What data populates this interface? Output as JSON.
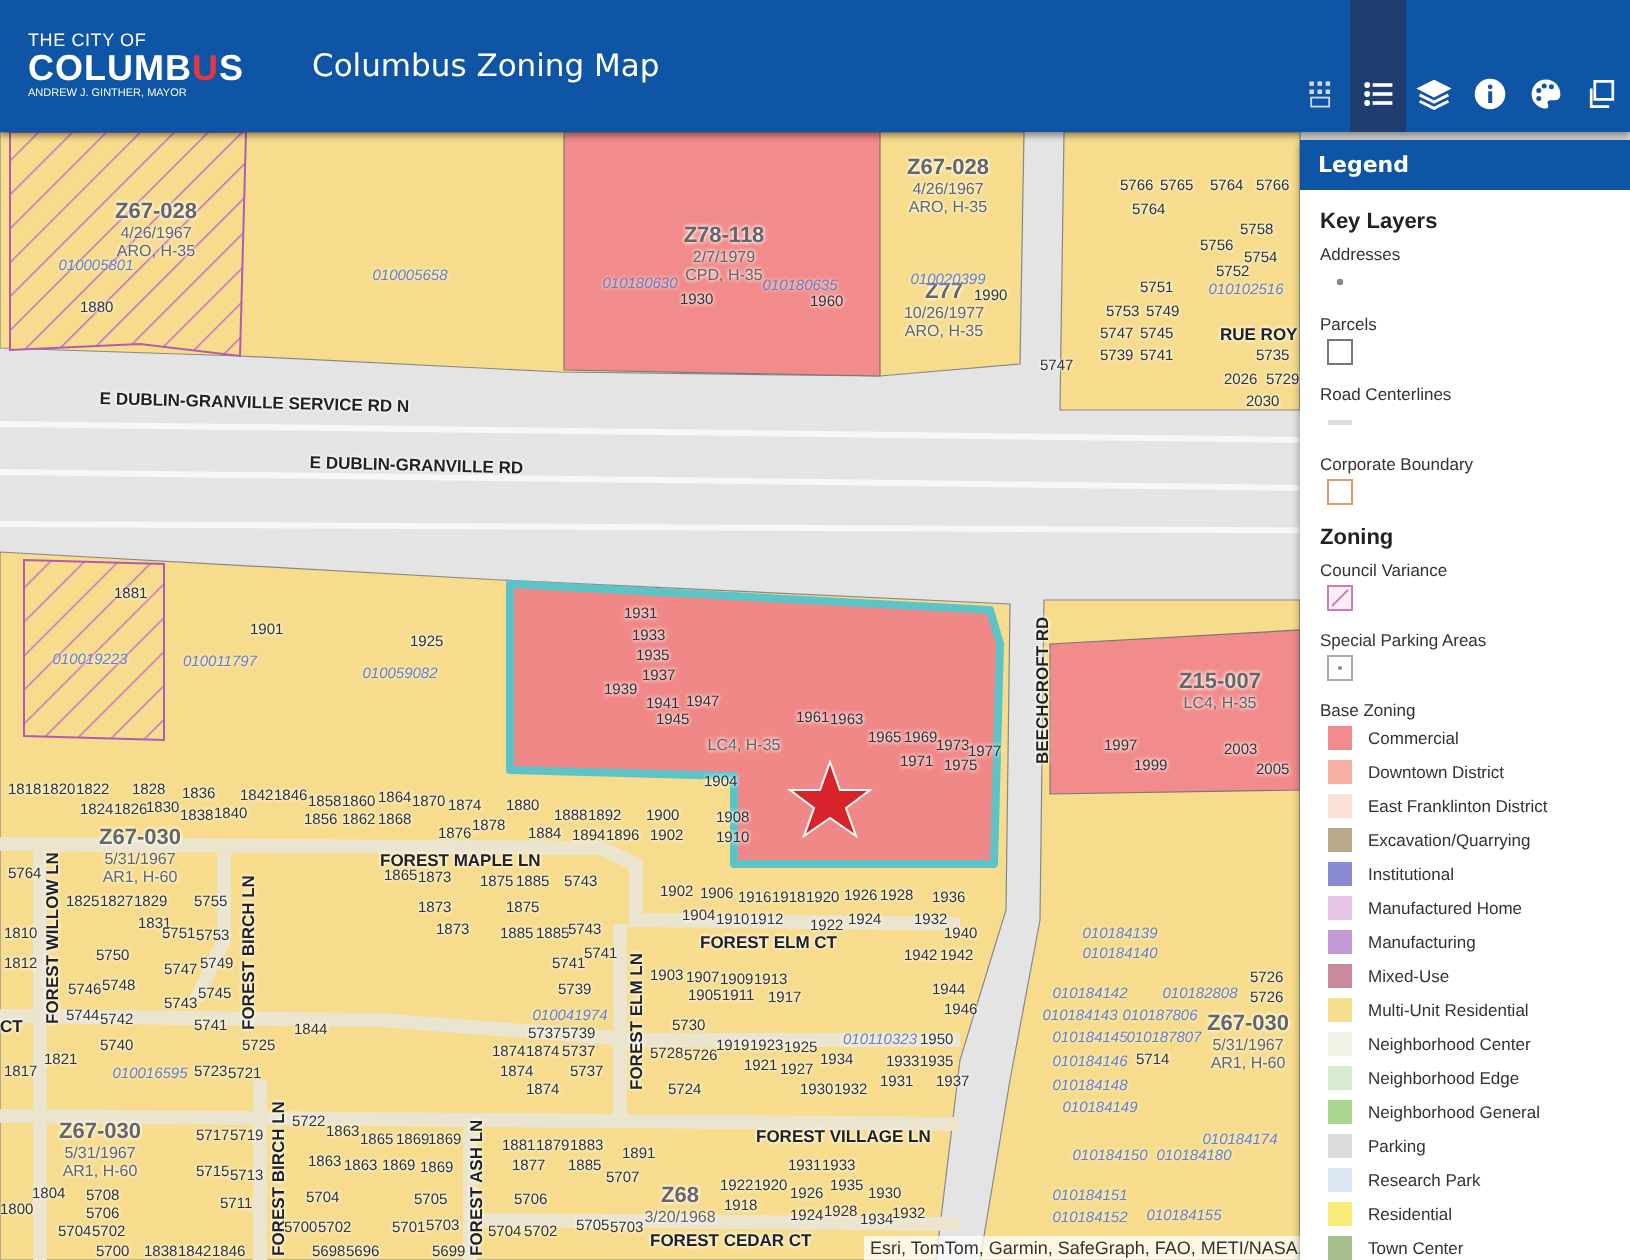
{
  "header": {
    "logo": {
      "line1": "THE CITY OF",
      "name_parts": [
        {
          "text": "COLUMB",
          "accent": false
        },
        {
          "text": "U",
          "accent": true
        },
        {
          "text": "S",
          "accent": false
        }
      ],
      "tagline": "ANDREW J. GINTHER, MAYOR"
    },
    "title": "Columbus Zoning Map",
    "tools": [
      {
        "kind": "basemap",
        "selected": false
      },
      {
        "kind": "legend",
        "selected": true
      },
      {
        "kind": "layers",
        "selected": false
      },
      {
        "kind": "info",
        "selected": false
      },
      {
        "kind": "palette",
        "selected": false
      },
      {
        "kind": "print",
        "selected": false
      }
    ]
  },
  "legend": {
    "title": "Legend",
    "sections": [
      {
        "heading": "Key Layers",
        "items": [
          {
            "label": "Addresses",
            "kind": "point"
          },
          {
            "label": "Parcels",
            "kind": "parcel"
          },
          {
            "label": "Road Centerlines",
            "kind": "line"
          },
          {
            "label": "Corporate Boundary",
            "kind": "boundary"
          }
        ]
      },
      {
        "heading": "Zoning",
        "items": [
          {
            "label": "Council Variance",
            "kind": "hatch"
          },
          {
            "label": "Special Parking Areas",
            "kind": "parking"
          }
        ],
        "group": {
          "label": "Base Zoning",
          "items": [
            {
              "label": "Commercial",
              "color": "#f28b8b"
            },
            {
              "label": "Downtown District",
              "color": "#f7b1a4"
            },
            {
              "label": "East Franklinton District",
              "color": "#fbe0d8"
            },
            {
              "label": "Excavation/Quarrying",
              "color": "#b9a889"
            },
            {
              "label": "Institutional",
              "color": "#8a8bd2"
            },
            {
              "label": "Manufactured Home",
              "color": "#e7c6e8"
            },
            {
              "label": "Manufacturing",
              "color": "#c49ad6"
            },
            {
              "label": "Mixed-Use",
              "color": "#c98a9a"
            },
            {
              "label": "Multi-Unit Residential",
              "color": "#f6df8e"
            },
            {
              "label": "Neighborhood Center",
              "color": "#eef3e3"
            },
            {
              "label": "Neighborhood Edge",
              "color": "#d8ecd2"
            },
            {
              "label": "Neighborhood General",
              "color": "#a9d68c"
            },
            {
              "label": "Parking",
              "color": "#dcdcdc"
            },
            {
              "label": "Research Park",
              "color": "#dde8f5"
            },
            {
              "label": "Residential",
              "color": "#fbec7a"
            },
            {
              "label": "Town Center",
              "color": "#a6bf8c"
            }
          ]
        }
      }
    ]
  },
  "map": {
    "streets": [
      "E DUBLIN-GRANVILLE SERVICE RD N",
      "E DUBLIN-GRANVILLE RD",
      "BEECHCROFT RD",
      "FOREST MAPLE LN",
      "FOREST ELM CT",
      "FOREST WILLOW LN",
      "FOREST BIRCH LN",
      "FOREST ELM LN",
      "FOREST VILLAGE LN",
      "FOREST BIRCH LN",
      "FOREST ASH LN",
      "FOREST CEDAR CT",
      "RUE ROY",
      "CT"
    ],
    "zoning_labels": [
      {
        "case": "Z67-028",
        "date": "4/26/1967",
        "district": "ARO, H-35"
      },
      {
        "case": "Z78-118",
        "date": "2/7/1979",
        "district": "CPD, H-35"
      },
      {
        "case": "Z67-028",
        "date": "4/26/1967",
        "district": "ARO, H-35"
      },
      {
        "case": "Z77",
        "date": "10/26/1977",
        "district": "ARO, H-35"
      },
      {
        "district": "LC4, H-35"
      },
      {
        "case": "Z67-030",
        "date": "5/31/1967",
        "district": "AR1, H-60"
      },
      {
        "case": "Z15-007",
        "district": "LC4, H-35"
      },
      {
        "case": "Z67-030",
        "date": "5/31/1967",
        "district": "AR1, H-60"
      },
      {
        "case": "Z67-030",
        "date": "5/31/1967",
        "district": "AR1, H-60"
      },
      {
        "case": "Z68",
        "date": "3/20/1968"
      }
    ],
    "parcel_ids": [
      "010005801",
      "010005658",
      "010180630",
      "010180635",
      "010020399",
      "010019223",
      "010011797",
      "010059082",
      "010016595",
      "010041974",
      "010110323",
      "010184139",
      "010184140",
      "010184142",
      "010182808",
      "010184143",
      "010187806",
      "010184145",
      "010187807",
      "010184146",
      "010184148",
      "010184149",
      "010184150",
      "010184180",
      "010184174",
      "010184151",
      "010184152",
      "010184155",
      "010102516"
    ],
    "addresses": [
      "1880",
      "1930",
      "1960",
      "1990",
      "5747",
      "5766",
      "5765",
      "5764",
      "5766",
      "5764",
      "5758",
      "5756",
      "5754",
      "5752",
      "5751",
      "5753",
      "5749",
      "5747",
      "5745",
      "5739",
      "5741",
      "5735",
      "2026",
      "5729",
      "2030",
      "1931",
      "1933",
      "1935",
      "1937",
      "1939",
      "1941",
      "1947",
      "1945",
      "1961",
      "1963",
      "1965",
      "1969",
      "1973",
      "1977",
      "1971",
      "1975",
      "1904",
      "1818",
      "1820",
      "1822",
      "1824",
      "1826",
      "1828",
      "1830",
      "1836",
      "1838",
      "1840",
      "1842",
      "1846",
      "1858",
      "1860",
      "1856",
      "1864",
      "1862",
      "1868",
      "1870",
      "1874",
      "1876",
      "1878",
      "1880",
      "1884",
      "1888",
      "1892",
      "1894",
      "1896",
      "1900",
      "1902",
      "1908",
      "1910",
      "1901",
      "1925",
      "1881",
      "5764",
      "1825",
      "1827",
      "1829",
      "1831",
      "5755",
      "5751",
      "5753",
      "5750",
      "5747",
      "5749",
      "5746",
      "5748",
      "1810",
      "1812",
      "5744",
      "5742",
      "5740",
      "5743",
      "5745",
      "5741",
      "1844",
      "1821",
      "1817",
      "1865",
      "1873",
      "1873",
      "1873",
      "1875",
      "1885",
      "1875",
      "1885",
      "1885",
      "5743",
      "5743",
      "5741",
      "5741",
      "5739",
      "5737",
      "5739",
      "1874",
      "1874",
      "5737",
      "1874",
      "5737",
      "1874",
      "1902",
      "1906",
      "1916",
      "1918",
      "1920",
      "1904",
      "1910",
      "1912",
      "1922",
      "1926",
      "1928",
      "1924",
      "1932",
      "1936",
      "1940",
      "1942",
      "1942",
      "1944",
      "1946",
      "1903",
      "1907",
      "1909",
      "1913",
      "1905",
      "1911",
      "1917",
      "5730",
      "5728",
      "5726",
      "1919",
      "1923",
      "1925",
      "1921",
      "1927",
      "1934",
      "1933",
      "1935",
      "1931",
      "1937",
      "1950",
      "5724",
      "1930",
      "1932",
      "5725",
      "5723",
      "5721",
      "5722",
      "1863",
      "1865",
      "1869",
      "1869",
      "1863",
      "1863",
      "1869",
      "1869",
      "5717",
      "5719",
      "5715",
      "5713",
      "5711",
      "5704",
      "5705",
      "5706",
      "5707",
      "5700",
      "5702",
      "5701",
      "5703",
      "5704",
      "5702",
      "5705",
      "5703",
      "5708",
      "5706",
      "5704",
      "5702",
      "1804",
      "1800",
      "1881",
      "1879",
      "1883",
      "1877",
      "1885",
      "1891",
      "1931",
      "1933",
      "1922",
      "1920",
      "1918",
      "1926",
      "1924",
      "1935",
      "1928",
      "1930",
      "1934",
      "1932",
      "5700",
      "1838",
      "1842",
      "1846",
      "5698",
      "5696",
      "5699",
      "1997",
      "1999",
      "2003",
      "2005",
      "5726",
      "5726",
      "5714"
    ],
    "attribution": "Esri, TomTom, Garmin, SafeGraph, FAO, METI/NASA,"
  }
}
